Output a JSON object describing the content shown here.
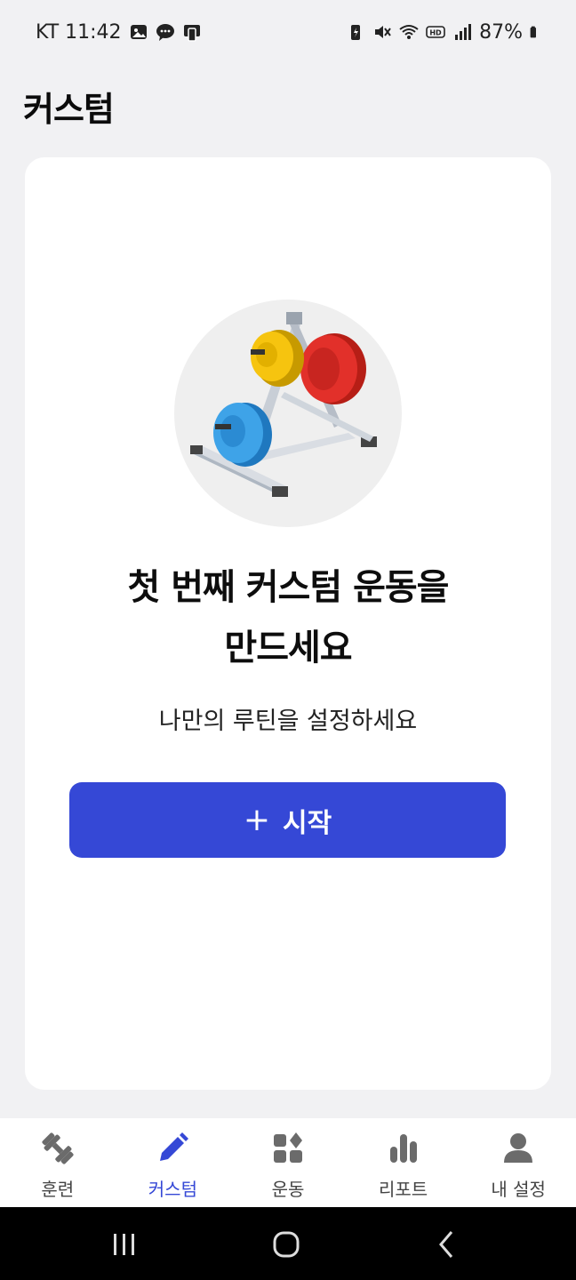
{
  "status_bar": {
    "carrier_time": "KT 11:42",
    "battery": "87%"
  },
  "header": {
    "title": "커스텀"
  },
  "empty_state": {
    "headline_line1": "첫 번째 커스텀 운동을",
    "headline_line2": "만드세요",
    "subtitle": "나만의 루틴을 설정하세요",
    "button_plus": "+",
    "button_label": "시작"
  },
  "colors": {
    "accent": "#3548d6",
    "background": "#f1f1f3",
    "card": "#ffffff",
    "nav_inactive": "#6b6b6b"
  },
  "bottom_nav": {
    "items": [
      {
        "label": "훈련",
        "icon": "dumbbell-icon",
        "active": false
      },
      {
        "label": "커스텀",
        "icon": "pencil-icon",
        "active": true
      },
      {
        "label": "운동",
        "icon": "grid-shapes-icon",
        "active": false
      },
      {
        "label": "리포트",
        "icon": "bar-chart-icon",
        "active": false
      },
      {
        "label": "내 설정",
        "icon": "person-icon",
        "active": false
      }
    ]
  },
  "system_nav": {
    "buttons": [
      "recent-apps",
      "home",
      "back"
    ]
  }
}
